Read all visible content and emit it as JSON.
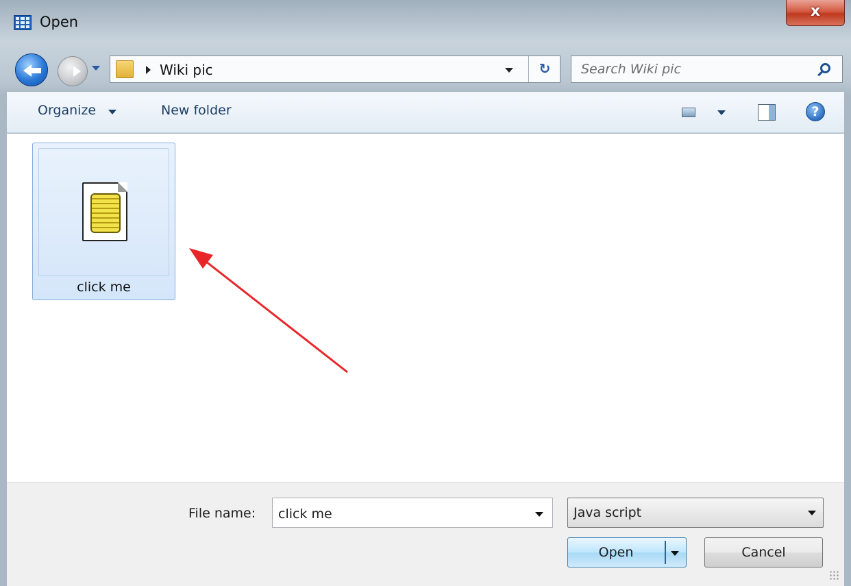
{
  "window": {
    "title": "Open",
    "close_label": "x"
  },
  "nav": {
    "breadcrumb": "Wiki pic"
  },
  "search": {
    "placeholder": "Search Wiki pic"
  },
  "toolbar": {
    "organize_label": "Organize",
    "new_folder_label": "New folder",
    "help_label": "?"
  },
  "files": [
    {
      "name": "click me",
      "icon": "javascript-file-icon",
      "selected": true
    }
  ],
  "footer": {
    "file_name_label": "File name:",
    "file_name_value": "click me",
    "file_type_value": "Java script",
    "open_label": "Open",
    "cancel_label": "Cancel"
  },
  "colors": {
    "selection": "#cce8ff",
    "annotation_arrow": "#e8262a",
    "close_button": "#c7452c"
  }
}
